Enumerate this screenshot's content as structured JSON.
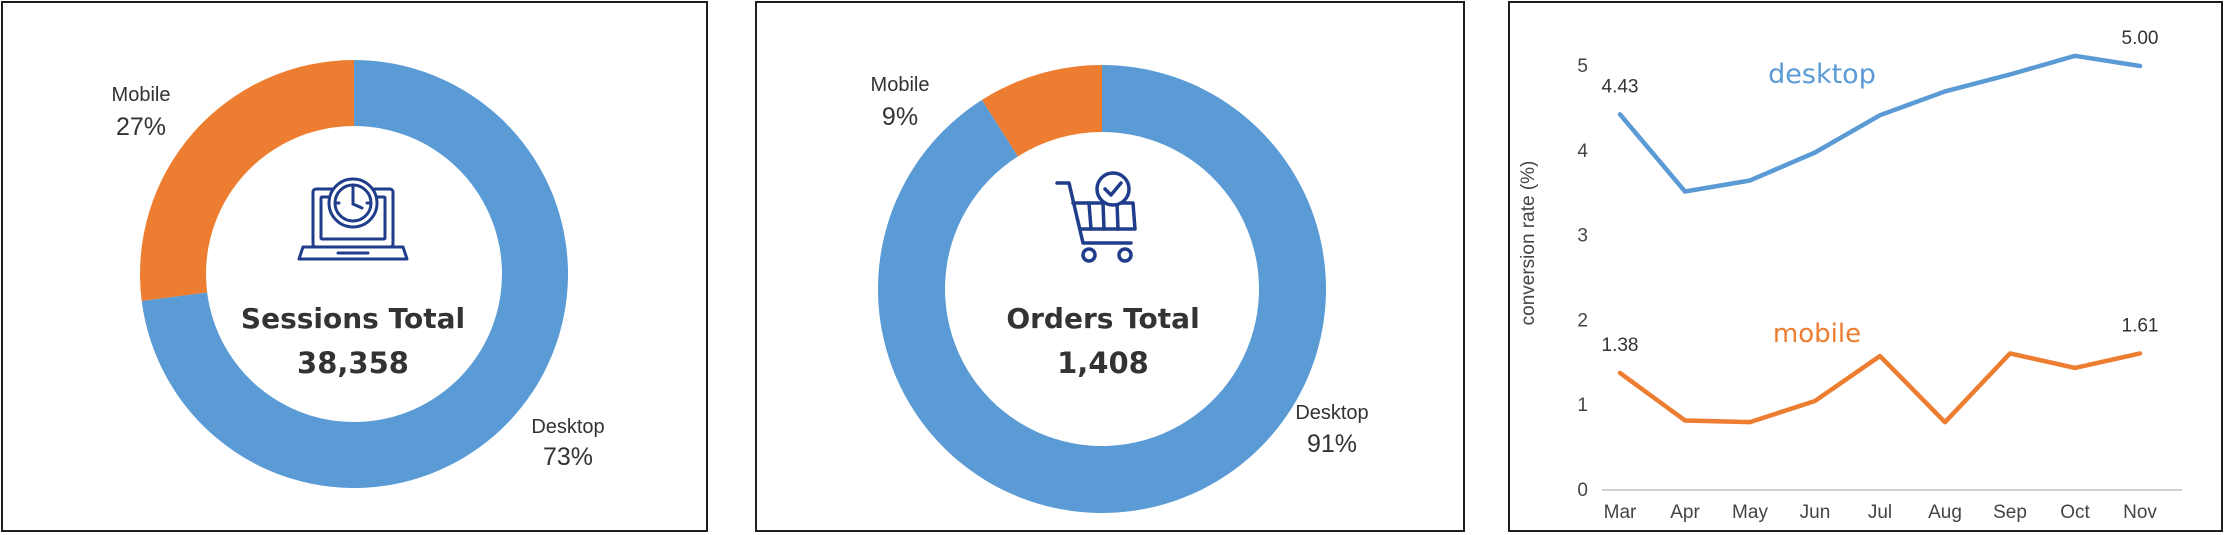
{
  "colors": {
    "desktop": "#5b9bd5",
    "mobile": "#ed7d31",
    "icon": "#1f3d8a"
  },
  "chart_data": [
    {
      "type": "pie",
      "style": "donut",
      "center_title": "Sessions Total",
      "center_value": "38,358",
      "center_icon": "laptop-clock-icon",
      "slices": [
        {
          "label": "Desktop",
          "value": 73,
          "display": "73%",
          "color": "#5b9bd5"
        },
        {
          "label": "Mobile",
          "value": 27,
          "display": "27%",
          "color": "#ed7d31"
        }
      ]
    },
    {
      "type": "pie",
      "style": "donut",
      "center_title": "Orders Total",
      "center_value": "1,408",
      "center_icon": "shopping-cart-check-icon",
      "slices": [
        {
          "label": "Desktop",
          "value": 91,
          "display": "91%",
          "color": "#5b9bd5"
        },
        {
          "label": "Mobile",
          "value": 9,
          "display": "9%",
          "color": "#ed7d31"
        }
      ]
    },
    {
      "type": "line",
      "categories": [
        "Mar",
        "Apr",
        "May",
        "Jun",
        "Jul",
        "Aug",
        "Sep",
        "Oct",
        "Nov"
      ],
      "ylabel": "conversion rate (%)",
      "xlabel": "",
      "ylim": [
        0,
        5.5
      ],
      "yticks": [
        0,
        1,
        2,
        3,
        4,
        5
      ],
      "grid": false,
      "series": [
        {
          "name": "desktop",
          "color": "#5b9bd5",
          "values": [
            4.43,
            3.52,
            3.65,
            3.98,
            4.42,
            4.7,
            4.9,
            5.12,
            5.0
          ],
          "labels": {
            "first": "4.43",
            "last": "5.00"
          }
        },
        {
          "name": "mobile",
          "color": "#ed7d31",
          "values": [
            1.38,
            0.82,
            0.8,
            1.05,
            1.58,
            0.8,
            1.61,
            1.44,
            1.61
          ],
          "labels": {
            "first": "1.38",
            "last": "1.61"
          }
        }
      ]
    }
  ]
}
